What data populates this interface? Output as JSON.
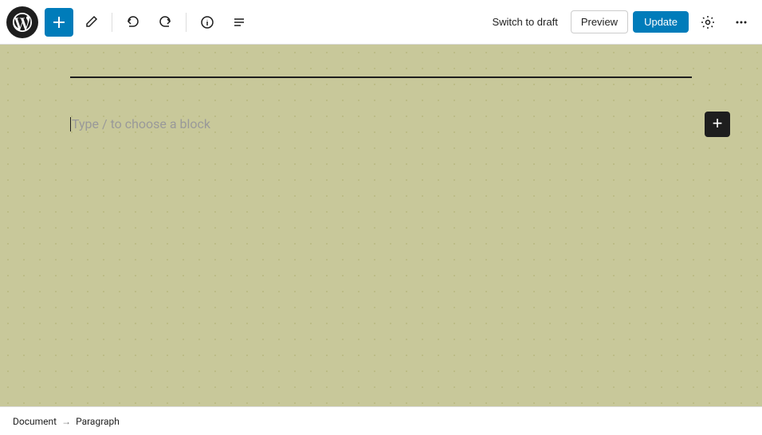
{
  "toolbar": {
    "add_button_label": "+",
    "switch_to_draft_label": "Switch to draft",
    "preview_label": "Preview",
    "update_label": "Update"
  },
  "editor": {
    "separator": true,
    "block_placeholder": "Type / to choose a block",
    "add_block_icon": "+"
  },
  "status_bar": {
    "document_label": "Document",
    "arrow": "→",
    "paragraph_label": "Paragraph"
  },
  "icons": {
    "wp_logo": "wordpress",
    "add": "plus",
    "edit": "pencil",
    "undo": "undo",
    "redo": "redo",
    "info": "info",
    "list": "list",
    "settings": "gear",
    "more": "ellipsis"
  },
  "colors": {
    "accent": "#007cba",
    "dark": "#1e1e1e",
    "bg": "#c8c89a"
  }
}
